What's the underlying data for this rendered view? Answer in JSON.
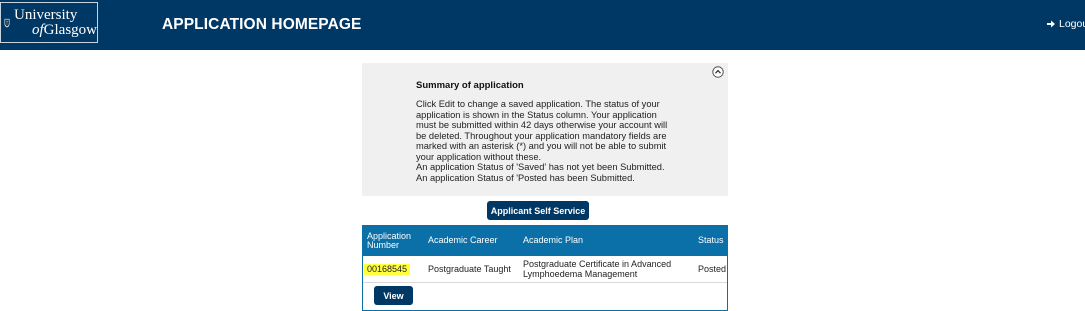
{
  "header": {
    "logo": {
      "line1": "University",
      "line2_of": "of",
      "line2": "Glasgow"
    },
    "title": "APPLICATION HOMEPAGE",
    "logout_label": "Logout"
  },
  "summary": {
    "title": "Summary of application",
    "lines": [
      "Click Edit to change a saved application. The status of your",
      "application is shown in the Status column.  Your application",
      "must be submitted within 42 days otherwise your account will",
      "be deleted.  Throughout your application mandatory fields are",
      "marked with an asterisk (*) and you will not be able  to submit",
      "your application without these.",
      "An application Status of 'Saved' has not yet been Submitted.",
      "An application Status of 'Posted has been Submitted."
    ]
  },
  "self_service_button": "Applicant Self Service",
  "table": {
    "headers": {
      "number_line1": "Application",
      "number_line2": "Number",
      "career": "Academic Career",
      "plan": "Academic Plan",
      "status": "Status"
    },
    "rows": [
      {
        "number": "00168545",
        "career": "Postgraduate Taught",
        "plan_line1": "Postgraduate Certificate in Advanced",
        "plan_line2": "Lymphoedema Management",
        "status": "Posted"
      }
    ],
    "view_button": "View"
  },
  "colors": {
    "header_bg": "#003865",
    "table_header_bg": "#0b6fa8",
    "summary_bg": "#f0f0f0",
    "highlight": "#ffff3c"
  }
}
